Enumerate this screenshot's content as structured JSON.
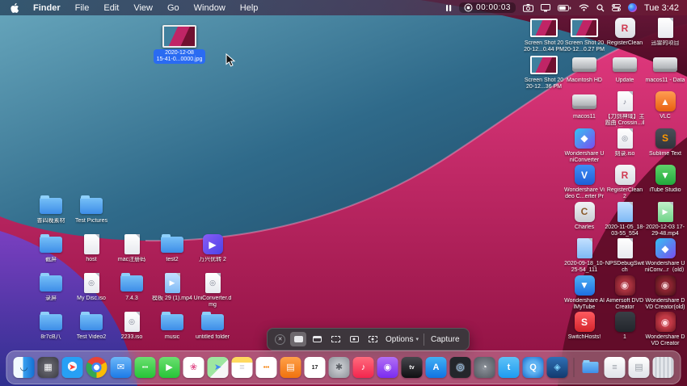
{
  "menu_bar": {
    "menus": [
      {
        "label": "Finder",
        "bold": true
      },
      {
        "label": "File",
        "bold": false
      },
      {
        "label": "Edit",
        "bold": false
      },
      {
        "label": "View",
        "bold": false
      },
      {
        "label": "Go",
        "bold": false
      },
      {
        "label": "Window",
        "bold": false
      },
      {
        "label": "Help",
        "bold": false
      }
    ],
    "status": {
      "timer": "00:00:03",
      "clock": "Tue 3:42"
    }
  },
  "preview": {
    "line1": "2020-12-08",
    "line2": "15-41-0...0000.jpg"
  },
  "screenshot_toolbar": {
    "options_label": "Options",
    "capture_label": "Capture",
    "chevron": "▾",
    "close_glyph": "✕",
    "modes": [
      {
        "name": "capture-entire-screen",
        "kind": "solid",
        "selected": true
      },
      {
        "name": "capture-selected-window",
        "kind": "window",
        "selected": false
      },
      {
        "name": "capture-selected-portion",
        "kind": "dashed",
        "selected": false
      },
      {
        "name": "record-entire-screen",
        "kind": "screen-dot",
        "selected": false
      },
      {
        "name": "record-selected-portion",
        "kind": "dashed-dot",
        "selected": false
      }
    ]
  },
  "desktop": {
    "left_items": [
      {
        "label": "普四晚素材",
        "type": "folder",
        "row": 0,
        "col": 0
      },
      {
        "label": "Test Pictures",
        "type": "folder",
        "row": 0,
        "col": 1
      },
      {
        "label": "截屏",
        "type": "folder",
        "row": 1,
        "col": 0
      },
      {
        "label": "host",
        "type": "file",
        "row": 1,
        "col": 1
      },
      {
        "label": "mac注册码",
        "type": "file",
        "row": 1,
        "col": 2
      },
      {
        "label": "test2",
        "type": "folder",
        "row": 1,
        "col": 3
      },
      {
        "label": "万兴优转 2",
        "type": "app",
        "bg": "linear-gradient(135deg,#8a5cf5,#4a43e8)",
        "glyph": "▶",
        "fg": "#ffffff",
        "row": 1,
        "col": 4
      },
      {
        "label": "录屏",
        "type": "folder",
        "row": 2,
        "col": 0
      },
      {
        "label": "My Disc.iso",
        "type": "file",
        "glyph": "◎",
        "row": 2,
        "col": 1
      },
      {
        "label": "7.4.3",
        "type": "folder",
        "row": 2,
        "col": 2
      },
      {
        "label": "模板 29 (1).mp4",
        "type": "file",
        "tint": "blue",
        "glyph": "▶",
        "row": 2,
        "col": 3
      },
      {
        "label": "UniConverter.dmg",
        "type": "file",
        "glyph": "◎",
        "row": 2,
        "col": 4
      },
      {
        "label": "8r7cB八",
        "type": "folder",
        "row": 3,
        "col": 0
      },
      {
        "label": "Test Video2",
        "type": "folder",
        "row": 3,
        "col": 1
      },
      {
        "label": "2233.iso",
        "type": "file",
        "glyph": "◎",
        "row": 3,
        "col": 2
      },
      {
        "label": "music",
        "type": "folder",
        "row": 3,
        "col": 3
      },
      {
        "label": "untitled folder",
        "type": "folder",
        "row": 3,
        "col": 4
      }
    ],
    "right_items": [
      {
        "label": "Screen Shot 2020-12...0.44 PM",
        "type": "image",
        "row": 0,
        "col": 0
      },
      {
        "label": "Screen Shot 2020-12...0.27 PM",
        "type": "image",
        "row": 0,
        "col": 1
      },
      {
        "label": "RegisterClean",
        "type": "app",
        "bg": "linear-gradient(180deg,#f5f6f8,#d9dce2)",
        "glyph": "R",
        "fg": "#d03a52",
        "row": 0,
        "col": 2
      },
      {
        "label": "迅雷的项目",
        "type": "file",
        "row": 0,
        "col": 3
      },
      {
        "label": "Screen Shot 2020-12...36 PM",
        "type": "image",
        "row": 1,
        "col": 0
      },
      {
        "label": "Macintosh HD",
        "type": "disk",
        "row": 1,
        "col": 1
      },
      {
        "label": "Update",
        "type": "disk",
        "row": 1,
        "col": 2
      },
      {
        "label": "macos11 - Data",
        "type": "disk",
        "row": 1,
        "col": 3
      },
      {
        "label": "macos11",
        "type": "disk",
        "row": 2,
        "col": 1
      },
      {
        "label": "【刀剑神域】主题曲 Crossin...ilbili.wav",
        "type": "file",
        "glyph": "♪",
        "row": 2,
        "col": 2
      },
      {
        "label": "VLC",
        "type": "app",
        "bg": "linear-gradient(180deg,#ff9d52,#e85e10)",
        "glyph": "▲",
        "fg": "#ffffff",
        "row": 2,
        "col": 3
      },
      {
        "label": "Wondershare UniConverter",
        "type": "app",
        "bg": "linear-gradient(135deg,#35c2f2,#7a4df0)",
        "glyph": "◆",
        "fg": "#ffffff",
        "row": 3,
        "col": 1
      },
      {
        "label": "刻录.iso",
        "type": "file",
        "glyph": "◎",
        "row": 3,
        "col": 2
      },
      {
        "label": "Sublime Text",
        "type": "app",
        "bg": "linear-gradient(180deg,#4a4f58,#30343b)",
        "glyph": "S",
        "fg": "#ff9800",
        "row": 3,
        "col": 3
      },
      {
        "label": "Wondershare Video C...erter Pro",
        "type": "app",
        "bg": "linear-gradient(180deg,#3f8ef5,#1f5fd6)",
        "glyph": "V",
        "fg": "#ffffff",
        "row": 4,
        "col": 1
      },
      {
        "label": "RegisterClean 2",
        "type": "app",
        "bg": "linear-gradient(180deg,#f5f6f8,#d9dce2)",
        "glyph": "R",
        "fg": "#d03a52",
        "row": 4,
        "col": 2
      },
      {
        "label": "iTube Studio",
        "type": "app",
        "bg": "linear-gradient(180deg,#5fd36a,#21a93c)",
        "glyph": "▼",
        "fg": "#ffffff",
        "row": 4,
        "col": 3
      },
      {
        "label": "Charles",
        "type": "app",
        "bg": "linear-gradient(180deg,#f2f3f5,#c9ccd3)",
        "glyph": "C",
        "fg": "#8a5a2a",
        "row": 5,
        "col": 1
      },
      {
        "label": "2020-11-05_18-03-55_554",
        "type": "file",
        "tint": "blue",
        "row": 5,
        "col": 2
      },
      {
        "label": "2020-12-03 17-29-48.mp4",
        "type": "file",
        "tint": "green",
        "glyph": "▶",
        "row": 5,
        "col": 3
      },
      {
        "label": "2020-09-18_10-25-54_111",
        "type": "file",
        "tint": "blue",
        "row": 6,
        "col": 1
      },
      {
        "label": "NPSDebugSwitch",
        "type": "file",
        "row": 6,
        "col": 2
      },
      {
        "label": "Wondershare UniConv...r（old）",
        "type": "app",
        "bg": "linear-gradient(135deg,#35c2f2,#7a4df0)",
        "glyph": "◆",
        "fg": "#ffffff",
        "row": 6,
        "col": 3
      },
      {
        "label": "Wondershare AllMyTube",
        "type": "app",
        "bg": "linear-gradient(180deg,#4fb2f5,#1e6fe0)",
        "glyph": "▼",
        "fg": "#ffffff",
        "row": 7,
        "col": 1
      },
      {
        "label": "Aimersoft DVD Creator",
        "type": "app",
        "bg": "radial-gradient(circle,#a8323e 40%,#5e1020)",
        "glyph": "◉",
        "fg": "#f5d0d5",
        "row": 7,
        "col": 2
      },
      {
        "label": "Wondershare DVD Creator(old)",
        "type": "app",
        "bg": "radial-gradient(circle,#8a2430 40%,#441016)",
        "glyph": "◉",
        "fg": "#f0c8cc",
        "row": 7,
        "col": 3
      },
      {
        "label": "SwitchHosts!",
        "type": "app",
        "bg": "linear-gradient(180deg,#ff5a5f,#d3242c)",
        "glyph": "S",
        "fg": "#ffffff",
        "row": 8,
        "col": 1
      },
      {
        "label": "1",
        "type": "app",
        "bg": "linear-gradient(180deg,#3a3f46,#22262b)",
        "glyph": "",
        "fg": "#ffffff",
        "row": 8,
        "col": 2
      },
      {
        "label": "Wondershare DVD Creator",
        "type": "app",
        "bg": "radial-gradient(circle,#c23a46 40%,#6e1420)",
        "glyph": "◉",
        "fg": "#ffd7db",
        "row": 8,
        "col": 3
      }
    ]
  },
  "dock": {
    "apps": [
      {
        "name": "finder",
        "bg": "linear-gradient(90deg,#f2fafe 0%,#f2fafe 46%,#3aa2f0 46%,#1470d2 100%)",
        "glyph": "◡",
        "fg": "#15476e"
      },
      {
        "name": "launchpad",
        "bg": "radial-gradient(circle,#72727a,#3b3b42)",
        "glyph": "▦",
        "fg": "#ffffff"
      },
      {
        "name": "safari",
        "bg": "radial-gradient(circle at 50% 45%,#eef7ff 0 29%,#27a0f5 30%)",
        "glyph": "➤",
        "fg": "#ff3b30"
      },
      {
        "name": "chrome",
        "round": true,
        "bg": "radial-gradient(circle,#ffffff 0 18%,#4285f4 19% 33%,rgba(0,0,0,0) 34%),conic-gradient(from -60deg,#ea4335 0 120deg,#fbbc05 0 240deg,#34a853 0 360deg)",
        "glyph": "",
        "fg": "#ffffff"
      },
      {
        "name": "mail",
        "bg": "linear-gradient(180deg,#6db8f8,#1c7ae6)",
        "glyph": "✉",
        "fg": "#ffffff"
      },
      {
        "name": "messages",
        "bg": "linear-gradient(180deg,#6ce070,#25c437)",
        "glyph": "•••",
        "fg": "#ffffff"
      },
      {
        "name": "facetime",
        "bg": "linear-gradient(180deg,#6ce070,#25c437)",
        "glyph": "▶",
        "fg": "#ffffff"
      },
      {
        "name": "photos",
        "bg": "#ffffff",
        "glyph": "❀",
        "fg": "#e2558e"
      },
      {
        "name": "maps",
        "bg": "linear-gradient(135deg,#9ee6a0 0 55%,#f6f6f6 55%)",
        "glyph": "➤",
        "fg": "#4285f4"
      },
      {
        "name": "notes",
        "bg": "linear-gradient(180deg,#ffd95e 0 27%,#ffffff 27%)",
        "glyph": "≡",
        "fg": "#c9c9cf"
      },
      {
        "name": "reminders",
        "bg": "#ffffff",
        "glyph": "•••",
        "fg": "#f57c00"
      },
      {
        "name": "books",
        "bg": "linear-gradient(180deg,#ffa149,#f0720e)",
        "glyph": "▤",
        "fg": "#ffffff"
      },
      {
        "name": "calendar",
        "bg": "#ffffff",
        "glyph": "17",
        "fg": "#222222"
      },
      {
        "name": "system-preferences",
        "bg": "radial-gradient(circle,#d4d7db,#8d9198)",
        "glyph": "✱",
        "fg": "#5a5e64"
      },
      {
        "name": "music",
        "bg": "linear-gradient(180deg,#ff6b7d,#f2254e)",
        "glyph": "♪",
        "fg": "#ffffff"
      },
      {
        "name": "podcasts",
        "bg": "linear-gradient(180deg,#b26ff5,#7a2bf0)",
        "glyph": "◉",
        "fg": "#ffffff"
      },
      {
        "name": "tv",
        "bg": "linear-gradient(180deg,#47474d,#0f0f12)",
        "glyph": "tv",
        "fg": "#ffffff"
      },
      {
        "name": "app-store",
        "bg": "linear-gradient(180deg,#41b0f5,#1173e2)",
        "glyph": "A",
        "fg": "#ffffff"
      },
      {
        "name": "photo-booth",
        "bg": "radial-gradient(circle,#5c646e 0 30%,#23262b 31%)",
        "glyph": "◎",
        "fg": "#9fd3ff"
      },
      {
        "name": "gray-utility-app",
        "bg": "radial-gradient(circle,#8d939b,#51565e)",
        "glyph": "◔",
        "fg": "#ffffff"
      },
      {
        "name": "twitter",
        "bg": "linear-gradient(180deg,#5ec2f7,#1d9bf0)",
        "glyph": "t",
        "fg": "#ffffff"
      },
      {
        "name": "quicktime",
        "bg": "radial-gradient(circle,#5eb2f2 0 40%,#1668c9)",
        "glyph": "Q",
        "fg": "#ffffff"
      },
      {
        "name": "dev-app",
        "bg": "linear-gradient(180deg,#2f6fb5,#123a6e)",
        "glyph": "◈",
        "fg": "#7fd4ff"
      }
    ],
    "stacks": [
      {
        "name": "downloads-stack",
        "kind": "folder",
        "glyph": "↓"
      },
      {
        "name": "documents-stack",
        "kind": "doc",
        "glyph": "≡"
      },
      {
        "name": "files-stack",
        "kind": "doc",
        "glyph": "▤"
      }
    ],
    "trash": {
      "name": "trash"
    }
  }
}
